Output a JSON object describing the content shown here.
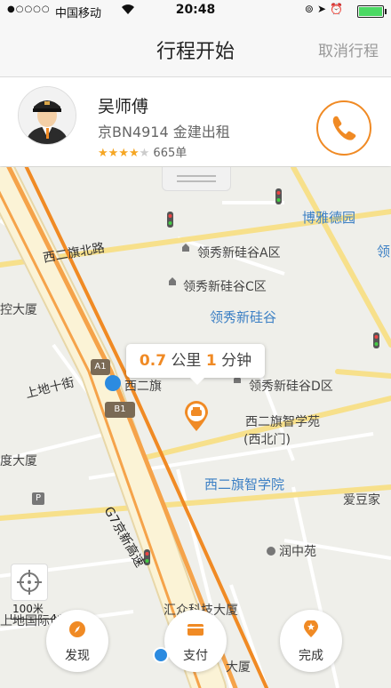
{
  "status_bar": {
    "signal": "●○○○○",
    "carrier": "中国移动",
    "time": "20:48"
  },
  "nav": {
    "title": "行程开始",
    "cancel_label": "取消行程"
  },
  "driver": {
    "name": "吴师傅",
    "car": "京BN4914 金建出租",
    "rating_stars": 4,
    "rating_max": 5,
    "orders": "665单"
  },
  "trip": {
    "distance_value": "0.7",
    "distance_unit": "公里",
    "time_value": "1",
    "time_unit": "分钟"
  },
  "map": {
    "labels": {
      "xierqi_north_road": "西二旗北路",
      "boya_deyuan": "博雅德园",
      "lingxiu_a": "领秀新硅谷A区",
      "lingxiu_c": "领秀新硅谷C区",
      "lingxiu": "领秀新硅谷",
      "lingxiu_d": "领秀新硅谷D区",
      "shangdi_shijie": "上地十街",
      "xierqi_station": "西二旗",
      "xierqi_zhixue_yuan": "西二旗智学苑",
      "xierqi_zhixue_yuan_gate": "(西北门)",
      "xierqi_zhixueyuan_blue": "西二旗智学院",
      "g7": "G7京新高速",
      "aidou_home": "爱豆家",
      "runzhong_yuan": "润中苑",
      "huizhong_tech": "汇众科技大厦",
      "kong_dasha": "控大厦",
      "du_dasha": "度大厦",
      "shangdi_partial": "上地国际创",
      "da_xia": "大厦",
      "ling_partial": "领",
      "exit_a1": "A1",
      "exit_b1": "B1"
    },
    "scale_label": "100米"
  },
  "bottom_actions": {
    "discover_label": "发现",
    "pay_label": "支付",
    "finish_label": "完成"
  },
  "colors": {
    "accent": "#f08a24",
    "map_blue": "#3b7fc4",
    "road_yellow": "#f7e08b",
    "highway_orange": "#f5a34a"
  }
}
